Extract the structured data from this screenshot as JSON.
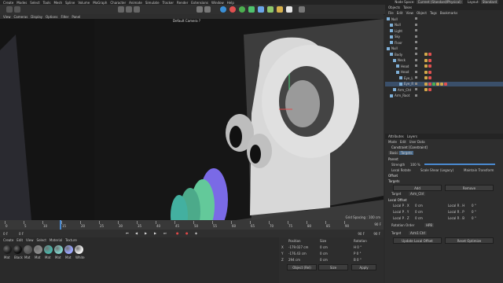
{
  "menubar": {
    "items": [
      "Create",
      "Modes",
      "Select",
      "Tools",
      "Mesh",
      "Spline",
      "Volume",
      "MoGraph",
      "Character",
      "Animate",
      "Simulate",
      "Tracker",
      "Render",
      "Extensions",
      "Window",
      "Help"
    ],
    "node_space_label": "Node Space:",
    "node_space_value": "Current (Standard/Physical)",
    "layout_label": "Layout:",
    "layout_value": "Standard"
  },
  "viewport": {
    "menu": [
      "View",
      "Cameras",
      "Display",
      "Options",
      "Filter",
      "Panel"
    ],
    "label": "Perspective",
    "camera": "Default Camera ?",
    "grid_spacing": "Grid Spacing : 100 cm"
  },
  "timeline": {
    "ticks": [
      "0",
      "5",
      "10",
      "15",
      "20",
      "25",
      "30",
      "35",
      "40",
      "45",
      "50",
      "55",
      "60",
      "65",
      "70",
      "75",
      "80",
      "85",
      "90"
    ],
    "current_frame": "0 F",
    "end_frame": "90 F"
  },
  "transport": {
    "start": "0 F",
    "start2": "0 F",
    "end": "90 F",
    "end2": "90 F"
  },
  "material_bar": {
    "menu": [
      "Create",
      "Edit",
      "View",
      "Select",
      "Material",
      "Texture"
    ],
    "materials": [
      {
        "name": "Mat",
        "color": "#1a1a1a"
      },
      {
        "name": "Black",
        "color": "#0d0d0d"
      },
      {
        "name": "Mat",
        "color": "#555555"
      },
      {
        "name": "Mat",
        "color": "#8a8a8a"
      },
      {
        "name": "Mat",
        "color": "#4bb3a8"
      },
      {
        "name": "Mat",
        "color": "#7fd1c9"
      },
      {
        "name": "Mat",
        "color": "#9aa7ff"
      },
      {
        "name": "White",
        "color": "#eeeeee"
      }
    ]
  },
  "coordinates": {
    "headers": [
      "Position",
      "Size",
      "Rotation"
    ],
    "rows": [
      {
        "axis": "X",
        "pos": "-179.027 cm",
        "size": "0 cm",
        "rot": "H 0 °"
      },
      {
        "axis": "Y",
        "pos": "-176.43 cm",
        "size": "0 cm",
        "rot": "P 0 °"
      },
      {
        "axis": "Z",
        "pos": "294 cm",
        "size": "0 cm",
        "rot": "B 0 °"
      }
    ],
    "mode_left": "Object (Rel)",
    "mode_mid": "Size",
    "apply": "Apply"
  },
  "object_manager": {
    "tabs": [
      "Objects",
      "Takes"
    ],
    "menu": [
      "File",
      "Edit",
      "View",
      "Object",
      "Tags",
      "Bookmarks"
    ],
    "objects": [
      "Null",
      "Null",
      "Light",
      "Sky",
      "Floor",
      "Null",
      "Body",
      "Neck",
      "Head",
      "Head",
      "Eye_L",
      "Eye_R",
      "Arm_Ctrl",
      "Arm_Root"
    ]
  },
  "attributes": {
    "tabs": [
      "Attributes",
      "Layers"
    ],
    "menu": [
      "Mode",
      "Edit",
      "User Data"
    ],
    "object_title": "Constraint [Constraint]",
    "sub_tabs": [
      "Basic",
      "Targets"
    ],
    "section": "Parent",
    "strength_label": "Strength",
    "strength_value": "100 %",
    "checkbox1": "Local Rotate",
    "checkbox2": "Scale Shear (Legacy)",
    "checkbox3": "Maintain Transform",
    "offset_section": "Offset",
    "targets_section": "Targets",
    "add_button": "Add",
    "remove_button": "Remove",
    "target_label": "Target",
    "target_value": "Arm_Ctrl",
    "local_offset_section": "Local Offset",
    "offsets": [
      {
        "label": "Local P . X",
        "value": "0 cm",
        "rlabel": "Local R . H",
        "rvalue": "0 °"
      },
      {
        "label": "Local P . Y",
        "value": "0 cm",
        "rlabel": "Local R . P",
        "rvalue": "0 °"
      },
      {
        "label": "Local P . Z",
        "value": "0 cm",
        "rlabel": "Local R . B",
        "rvalue": "0 °"
      }
    ],
    "rotation_order_label": "Rotation Order",
    "rotation_order_value": "HPB",
    "bottom_target_label": "Target",
    "bottom_target_value": "Arm1 Ctrl",
    "update_offset": "Update Local Offset",
    "reset_offset": "Reset Optimize"
  }
}
